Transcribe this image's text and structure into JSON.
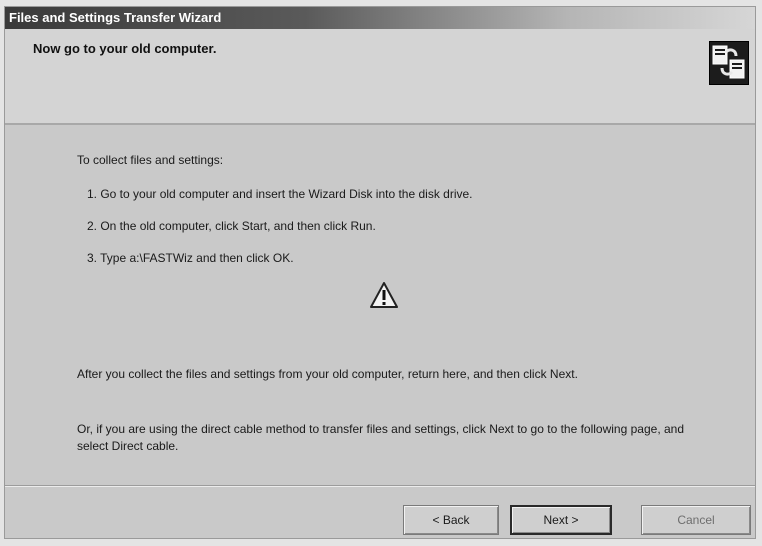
{
  "window": {
    "title": "Files and Settings Transfer Wizard"
  },
  "header": {
    "heading": "Now go to your old computer.",
    "icon": "wizard-transfer-icon"
  },
  "content": {
    "intro": "To collect files and settings:",
    "steps": [
      "1.  Go to your old computer and insert the Wizard Disk into the disk drive.",
      "2.  On the old computer, click Start, and then click Run.",
      "3.  Type a:\\FASTWiz and then click OK."
    ],
    "warning_icon": "warning-icon",
    "after_text": "After you collect the files and settings from your old computer, return here, and then click Next.",
    "cable_text": "Or, if you are using the direct cable method to transfer files and settings, click Next to go to the following page, and select Direct cable."
  },
  "buttons": {
    "back": "< Back",
    "next": "Next >",
    "cancel": "Cancel"
  }
}
